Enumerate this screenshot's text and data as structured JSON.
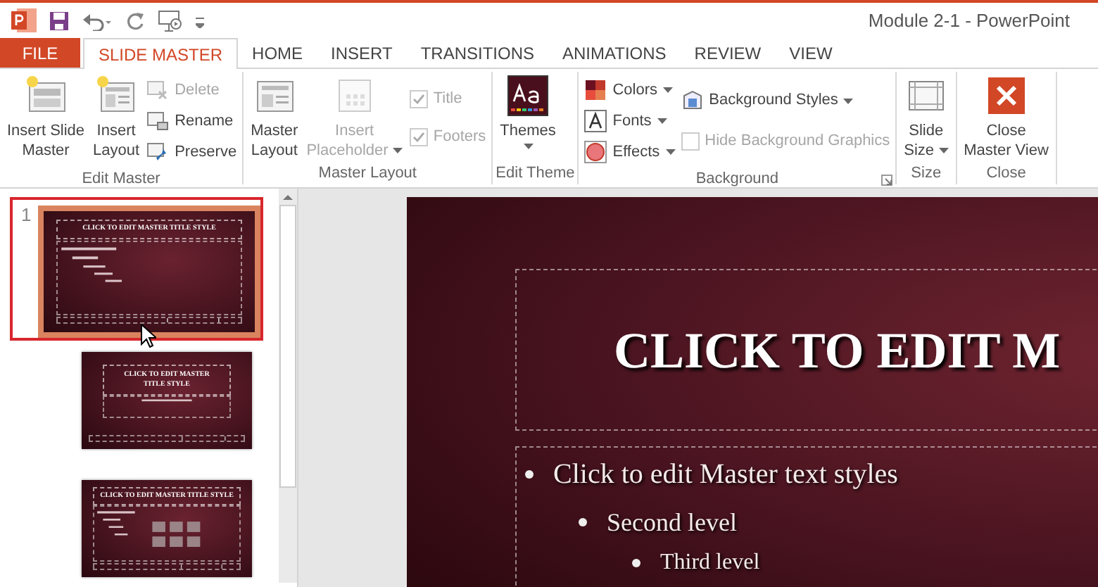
{
  "window": {
    "title": "Module 2-1 - PowerPoint"
  },
  "tabs": [
    {
      "label": "FILE",
      "kind": "file",
      "selected": false
    },
    {
      "label": "SLIDE MASTER",
      "kind": "tab",
      "selected": true
    },
    {
      "label": "HOME",
      "kind": "tab",
      "selected": false
    },
    {
      "label": "INSERT",
      "kind": "tab",
      "selected": false
    },
    {
      "label": "TRANSITIONS",
      "kind": "tab",
      "selected": false
    },
    {
      "label": "ANIMATIONS",
      "kind": "tab",
      "selected": false
    },
    {
      "label": "REVIEW",
      "kind": "tab",
      "selected": false
    },
    {
      "label": "VIEW",
      "kind": "tab",
      "selected": false
    }
  ],
  "ribbon": {
    "groups": [
      {
        "label": "Edit Master",
        "items": [
          {
            "kind": "large",
            "lines": [
              "Insert Slide",
              "Master"
            ],
            "disabled": false
          },
          {
            "kind": "large",
            "lines": [
              "Insert",
              "Layout"
            ],
            "disabled": false
          },
          {
            "kind": "small",
            "label": "Delete",
            "disabled": true
          },
          {
            "kind": "small",
            "label": "Rename",
            "disabled": false
          },
          {
            "kind": "small",
            "label": "Preserve",
            "disabled": false
          }
        ]
      },
      {
        "label": "Master Layout",
        "items": [
          {
            "kind": "large",
            "lines": [
              "Master",
              "Layout"
            ],
            "disabled": false
          },
          {
            "kind": "large",
            "lines": [
              "Insert",
              "Placeholder"
            ],
            "disabled": true,
            "dropdown": true
          },
          {
            "kind": "check",
            "label": "Title",
            "disabled": true,
            "checked": true
          },
          {
            "kind": "check",
            "label": "Footers",
            "disabled": true,
            "checked": true
          }
        ]
      },
      {
        "label": "Edit Theme",
        "items": [
          {
            "kind": "large",
            "lines": [
              "Themes"
            ],
            "disabled": false,
            "dropdown": true
          }
        ]
      },
      {
        "label": "Background",
        "launcher": true,
        "items": [
          {
            "kind": "small",
            "label": "Colors",
            "disabled": false,
            "dropdown": true
          },
          {
            "kind": "small",
            "label": "Fonts",
            "disabled": false,
            "dropdown": true
          },
          {
            "kind": "small",
            "label": "Effects",
            "disabled": false,
            "dropdown": true
          },
          {
            "kind": "small",
            "label": "Background Styles",
            "disabled": false,
            "dropdown": true
          },
          {
            "kind": "check",
            "label": "Hide Background Graphics",
            "disabled": true,
            "checked": false
          }
        ]
      },
      {
        "label": "Size",
        "items": [
          {
            "kind": "large",
            "lines": [
              "Slide",
              "Size"
            ],
            "disabled": false,
            "dropdown": true
          }
        ]
      },
      {
        "label": "Close",
        "items": [
          {
            "kind": "large",
            "lines": [
              "Close",
              "Master View"
            ],
            "disabled": false
          }
        ]
      }
    ]
  },
  "thumbnails": [
    {
      "number": "1",
      "kind": "master",
      "title": "CLICK TO EDIT MASTER TITLE STYLE",
      "selected": true
    },
    {
      "kind": "title-layout",
      "title": "CLICK TO EDIT MASTER TITLE STYLE",
      "selected": false
    },
    {
      "kind": "content-layout",
      "title": "CLICK TO EDIT MASTER TITLE STYLE",
      "selected": false
    }
  ],
  "slide": {
    "title": "CLICK TO EDIT M",
    "bullets": [
      {
        "text": "Click to edit Master text styles",
        "children": [
          {
            "text": "Second level",
            "children": [
              {
                "text": "Third level"
              }
            ]
          }
        ]
      }
    ]
  }
}
